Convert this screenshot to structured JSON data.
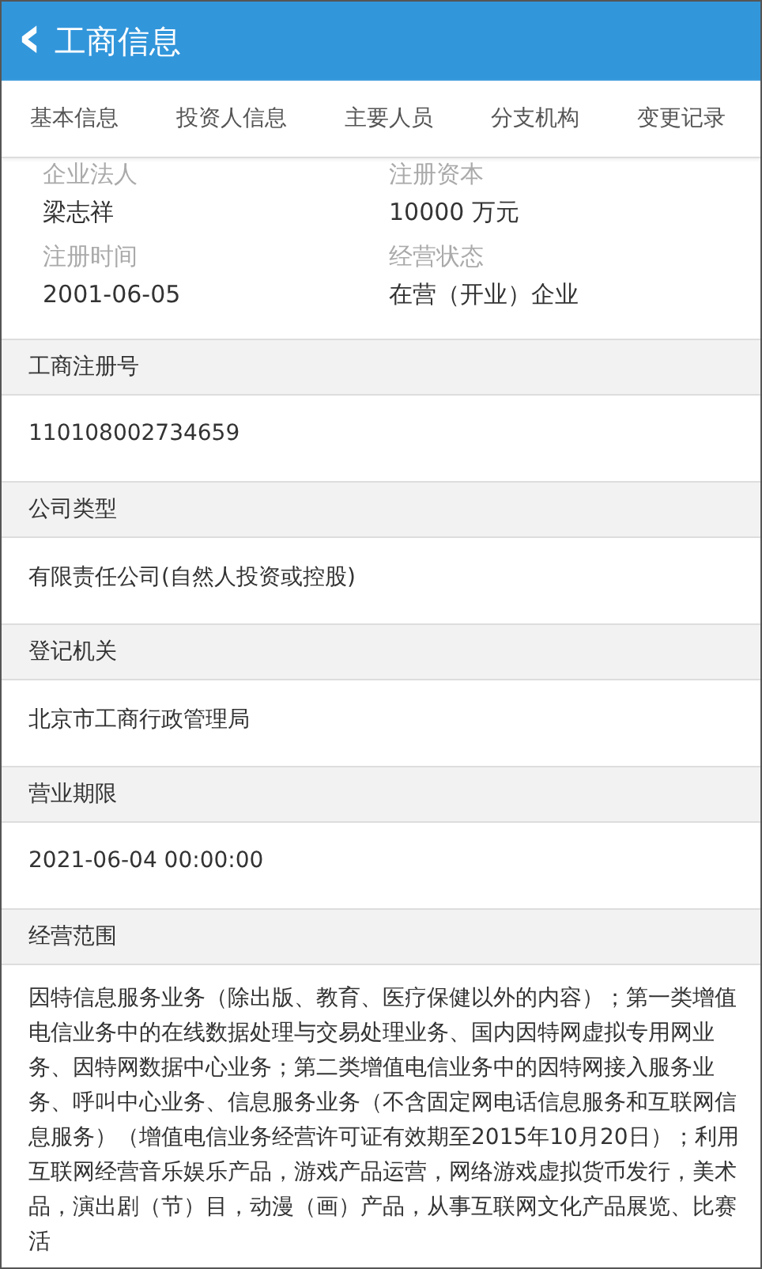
{
  "header": {
    "back": "‹",
    "title": "工商信息"
  },
  "tabs": [
    "基本信息",
    "投资人信息",
    "主要人员",
    "分支机构",
    "变更记录"
  ],
  "summary": [
    {
      "label": "企业法人",
      "value": "梁志祥"
    },
    {
      "label": "注册资本",
      "value": "10000 万元"
    },
    {
      "label": "注册时间",
      "value": "2001-06-05"
    },
    {
      "label": "经营状态",
      "value": "在营（开业）企业"
    }
  ],
  "sections": [
    {
      "heading": "工商注册号",
      "value": "110108002734659"
    },
    {
      "heading": "公司类型",
      "value": "有限责任公司(自然人投资或控股)"
    },
    {
      "heading": "登记机关",
      "value": "北京市工商行政管理局"
    },
    {
      "heading": "营业期限",
      "value": "2021-06-04 00:00:00"
    },
    {
      "heading": "经营范围",
      "value": "因特信息服务业务（除出版、教育、医疗保健以外的内容）；第一类增值电信业务中的在线数据处理与交易处理业务、国内因特网虚拟专用网业务、因特网数据中心业务；第二类增值电信业务中的因特网接入服务业务、呼叫中心业务、信息服务业务（不含固定网电话信息服务和互联网信息服务）（增值电信业务经营许可证有效期至2015年10月20日）；利用互联网经营音乐娱乐产品，游戏产品运营，网络游戏虚拟货币发行，美术品，演出剧（节）目，动漫（画）产品，从事互联网文化产品展览、比赛活"
    }
  ]
}
